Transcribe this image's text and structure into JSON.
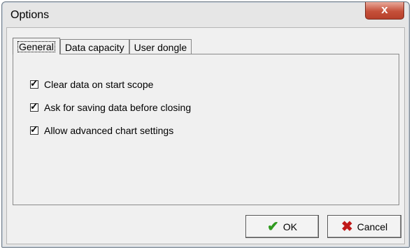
{
  "window": {
    "title": "Options",
    "close_glyph": "x"
  },
  "tabs": [
    {
      "label": "General",
      "active": true
    },
    {
      "label": "Data capacity",
      "active": false
    },
    {
      "label": "User dongle",
      "active": false
    }
  ],
  "options": [
    {
      "label": "Clear data on start scope",
      "checked": true
    },
    {
      "label": "Ask for saving data before closing",
      "checked": true
    },
    {
      "label": "Allow advanced chart settings",
      "checked": true
    }
  ],
  "buttons": {
    "ok": {
      "label": "OK",
      "icon": "checkmark-icon",
      "icon_glyph": "✔"
    },
    "cancel": {
      "label": "Cancel",
      "icon": "x-icon",
      "icon_glyph": "✖"
    }
  },
  "checkmark_glyph": "✓"
}
